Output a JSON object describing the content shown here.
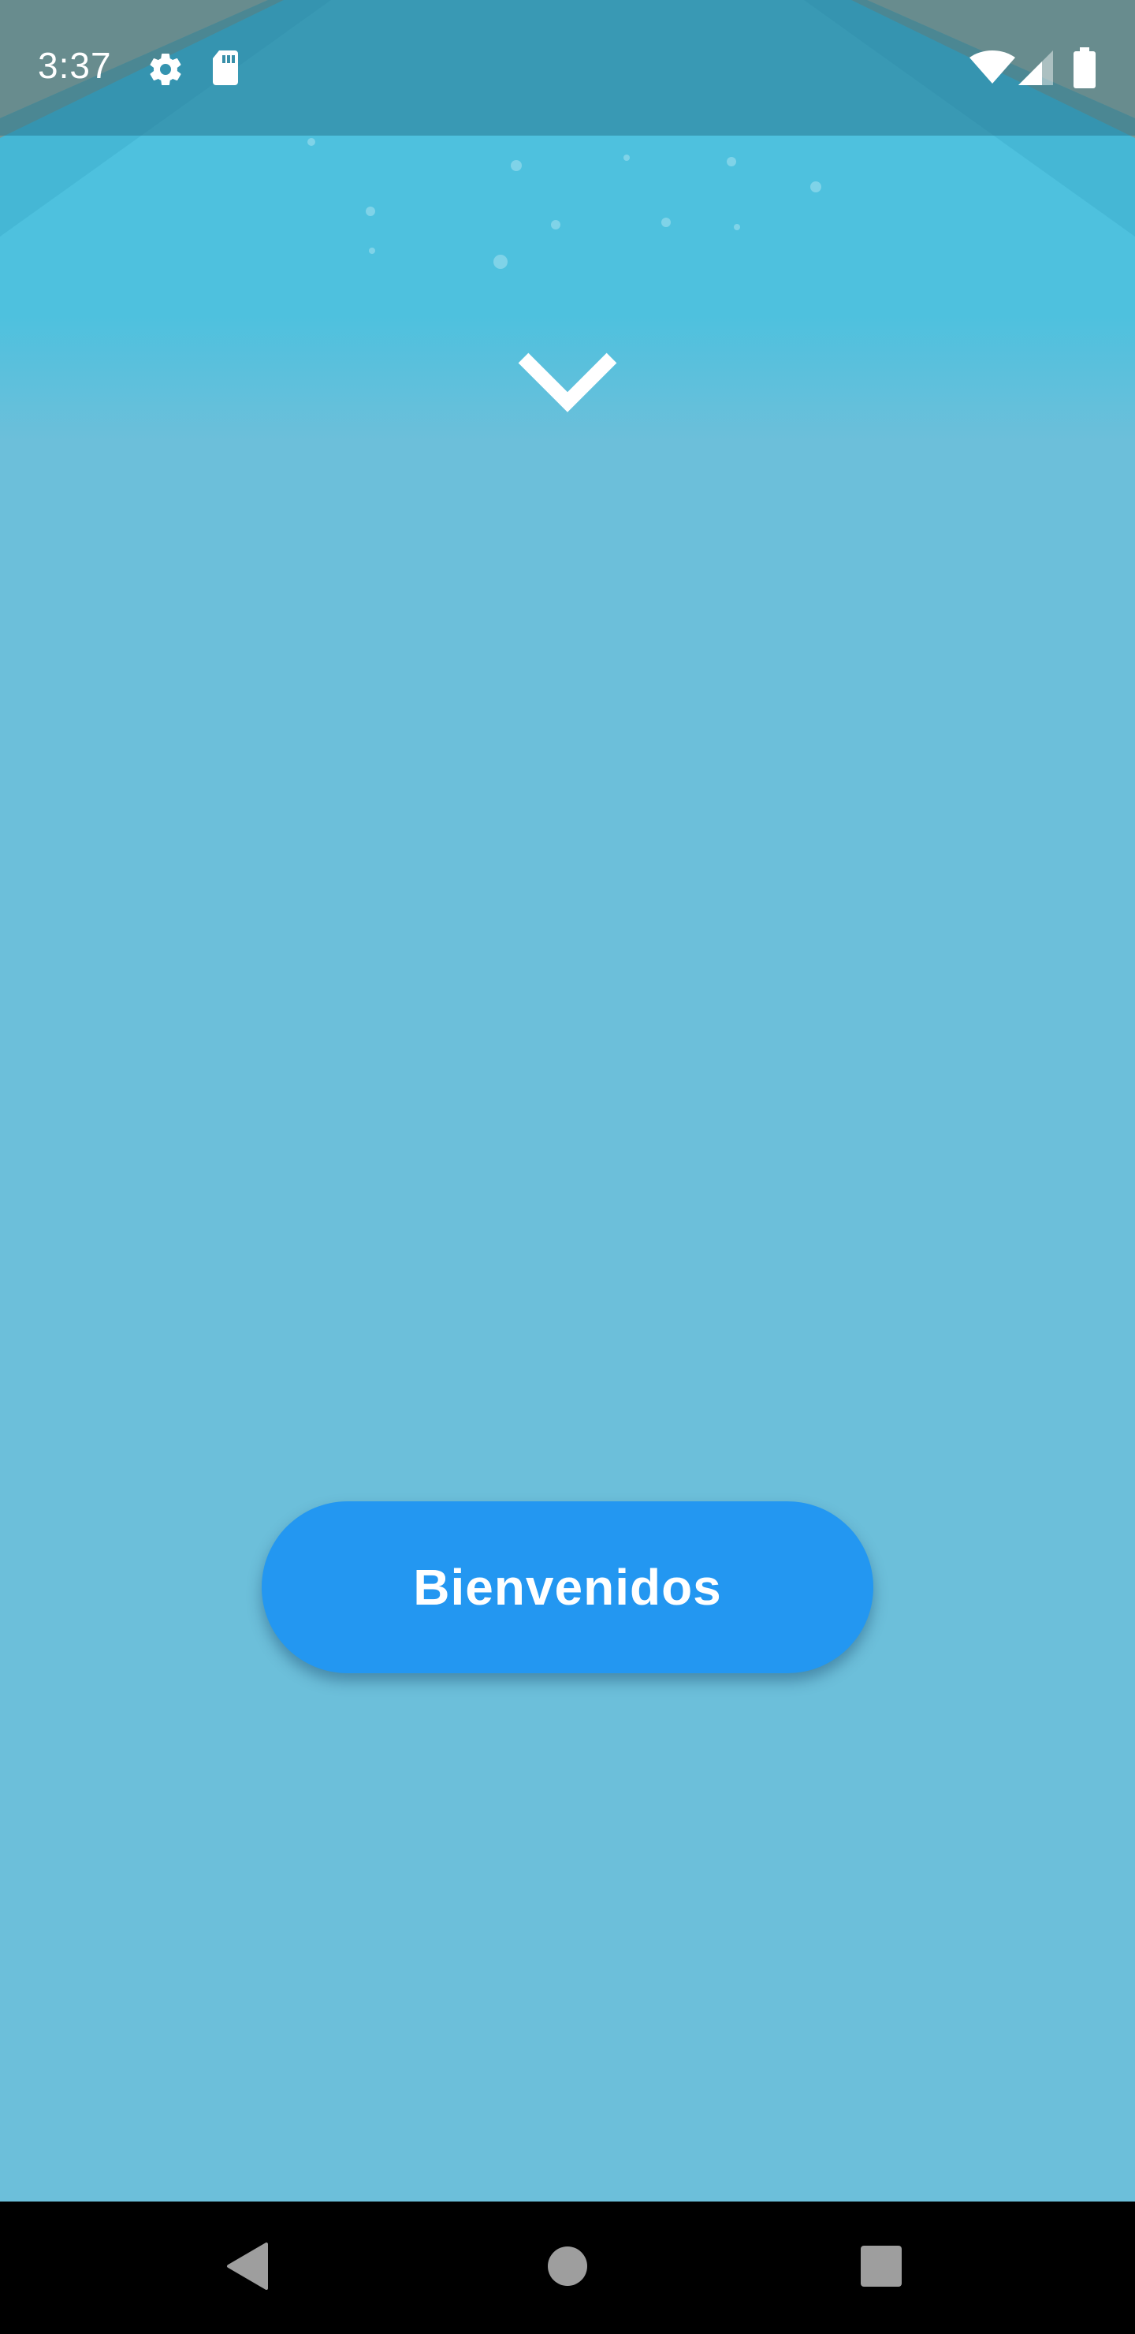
{
  "status_bar": {
    "time": "3:37",
    "icons": [
      "settings-icon",
      "sd-card-icon",
      "wifi-icon",
      "signal-icon",
      "battery-icon"
    ]
  },
  "main": {
    "expand_icon": "chevron-down-icon",
    "welcome_button_label": "Bienvenidos"
  },
  "navigation_bar": {
    "buttons": [
      "back-icon",
      "home-icon",
      "recents-icon"
    ]
  },
  "colors": {
    "background": "#6cbfda",
    "pool_water": "#4ec1de",
    "pool_deck": "#b5a58a",
    "button": "#2397f1",
    "button_text": "#ffffff",
    "nav_bar": "#000000"
  }
}
